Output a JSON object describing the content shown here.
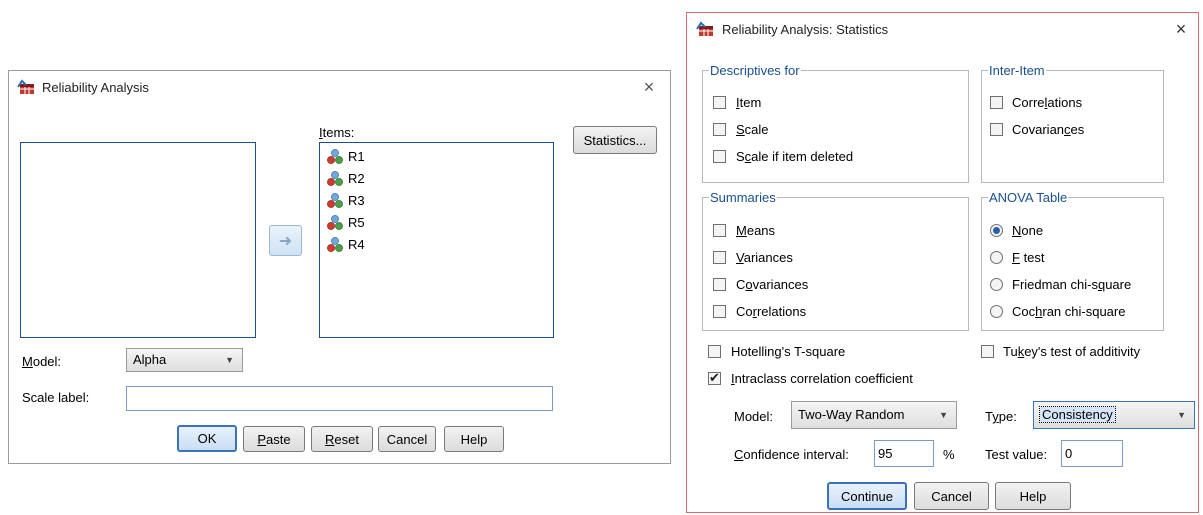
{
  "left_dialog": {
    "title": "Reliability Analysis",
    "close": "×",
    "items_label": "Items:",
    "items": [
      {
        "label": "R1"
      },
      {
        "label": "R2"
      },
      {
        "label": "R3"
      },
      {
        "label": "R5"
      },
      {
        "label": "R4"
      }
    ],
    "statistics_button": "Statistics...",
    "model_label": "Model:",
    "model_value": "Alpha",
    "scale_label_label": "Scale label:",
    "scale_label_value": "",
    "buttons": {
      "ok": "OK",
      "paste": "Paste",
      "reset": "Reset",
      "cancel": "Cancel",
      "help": "Help"
    }
  },
  "right_dialog": {
    "title": "Reliability Analysis: Statistics",
    "close": "×",
    "descriptives": {
      "legend": "Descriptives for",
      "item": {
        "label": "Item",
        "checked": false
      },
      "scale": {
        "label": "Scale",
        "checked": false
      },
      "scale_if_deleted": {
        "label": "Scale if item deleted",
        "checked": false
      }
    },
    "inter_item": {
      "legend": "Inter-Item",
      "correlations": {
        "label": "Correlations",
        "checked": false
      },
      "covariances": {
        "label": "Covariances",
        "checked": false
      }
    },
    "summaries": {
      "legend": "Summaries",
      "means": {
        "label": "Means",
        "checked": false
      },
      "variances": {
        "label": "Variances",
        "checked": false
      },
      "covariances": {
        "label": "Covariances",
        "checked": false
      },
      "correlations": {
        "label": "Correlations",
        "checked": false
      }
    },
    "anova": {
      "legend": "ANOVA Table",
      "none": {
        "label": "None",
        "selected": true
      },
      "f_test": {
        "label": "F test",
        "selected": false
      },
      "friedman": {
        "label": "Friedman chi-square",
        "selected": false
      },
      "cochran": {
        "label": "Cochran chi-square",
        "selected": false
      }
    },
    "hotelling": {
      "label": "Hotelling's T-square",
      "checked": false
    },
    "tukey": {
      "label": "Tukey's test of additivity",
      "checked": false
    },
    "intraclass": {
      "label": "Intraclass correlation coefficient",
      "checked": true
    },
    "model_label": "Model:",
    "model_value": "Two-Way Random",
    "type_label": "Type:",
    "type_value": "Consistency",
    "ci_label": "Confidence interval:",
    "ci_value": "95",
    "ci_unit": "%",
    "test_value_label": "Test value:",
    "test_value": "0",
    "buttons": {
      "continue": "Continue",
      "cancel": "Cancel",
      "help": "Help"
    }
  },
  "colors": {
    "accent": "#3b73b9",
    "legend_text": "#1a4f8f",
    "dialog_border_right": "#e06b6b",
    "dialog_border_left": "#9a9a9a",
    "bottom_bar": "#f0f0f0"
  }
}
